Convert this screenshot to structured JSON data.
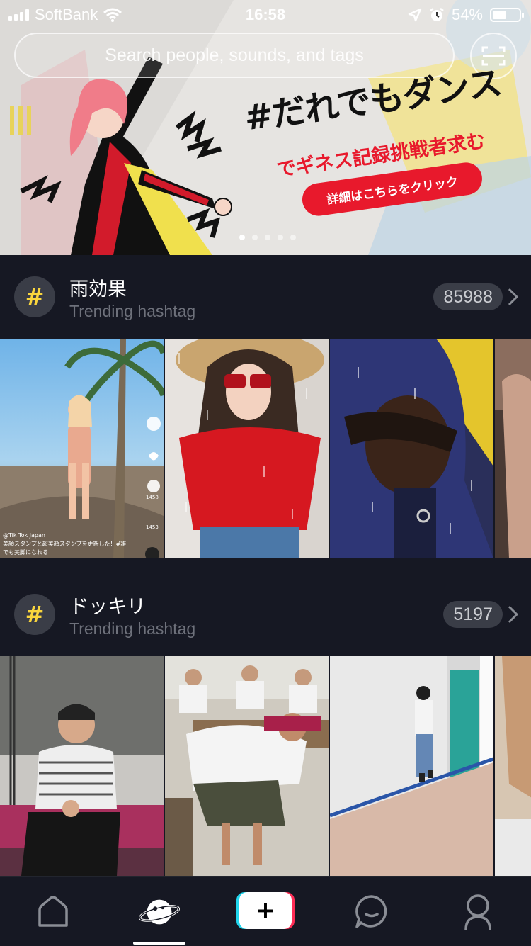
{
  "status_bar": {
    "carrier": "SoftBank",
    "time": "16:58",
    "battery": "54%",
    "battery_level": 0.54
  },
  "search": {
    "placeholder": "Search people, sounds, and tags"
  },
  "banner": {
    "title": "#だれでもダンス",
    "subtitle": "でギネス記録挑戦者求む",
    "cta": "詳細はこちらをクリック",
    "slide_count": 5,
    "active_slide": 0
  },
  "sections": [
    {
      "tag": "雨効果",
      "subtitle": "Trending hashtag",
      "count": "85988",
      "thumb_overlay": {
        "handle": "@Tik Tok Japan",
        "caption_line1": "美顔スタンプと超美顔スタンプを更新した！#誰",
        "caption_line2": "でも美脚になれる",
        "likes": "",
        "comments": "1458",
        "shares": "1453"
      }
    },
    {
      "tag": "ドッキリ",
      "subtitle": "Trending hashtag",
      "count": "5197"
    }
  ],
  "nav": {
    "items": [
      "home-icon",
      "discover-icon",
      "add-icon",
      "inbox-icon",
      "profile-icon"
    ],
    "active": "discover"
  },
  "colors": {
    "background": "#161823",
    "hashtag_yellow": "#f9d53d",
    "accent_red": "#e8192c",
    "tiktok_cyan": "#20d5ec",
    "tiktok_pink": "#fe2c55"
  }
}
